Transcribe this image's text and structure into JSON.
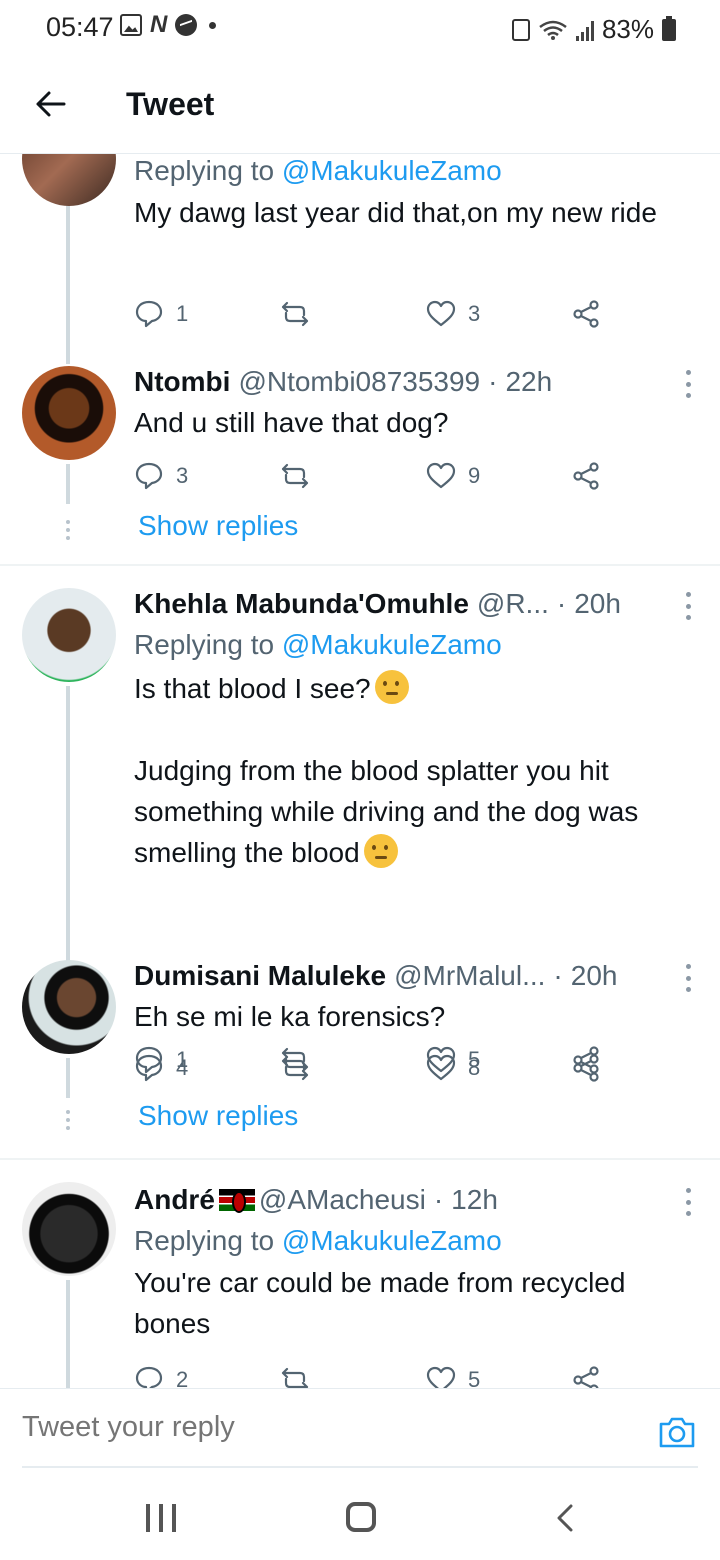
{
  "status_bar": {
    "time": "05:47",
    "battery": "83%"
  },
  "header": {
    "title": "Tweet"
  },
  "tweets": [
    {
      "name": "",
      "handle": "",
      "time": "",
      "replying_to_prefix": "Replying to ",
      "replying_to_handle": "@MakukuleZamo",
      "text": "My dawg last year did that,on my new ride",
      "replies": "1",
      "retweets": "",
      "likes": "3",
      "avatar_color": "#7a4a3a"
    },
    {
      "name": "Ntombi",
      "handle": "@Ntombi08735399",
      "time": "22h",
      "text": "And u still have that dog?",
      "replies": "3",
      "retweets": "",
      "likes": "9",
      "show_replies": "Show replies",
      "avatar_color": "#8a4a1c"
    },
    {
      "name": "Khehla Mabunda'Omuhle",
      "handle": "@R...",
      "time": "20h",
      "replying_to_prefix": "Replying to ",
      "replying_to_handle": "@MakukuleZamo",
      "text_line1": "Is that blood I see?",
      "text_rest": "Judging from the blood splatter you hit something while driving and the dog was smelling the blood",
      "replies": "1",
      "retweets": "",
      "likes": "5",
      "avatar_color": "#c9d3d8"
    },
    {
      "name": "Dumisani Maluleke",
      "handle": "@MrMalul...",
      "time": "20h",
      "text": "Eh se mi le ka forensics?",
      "replies": "4",
      "retweets": "",
      "likes": "8",
      "show_replies": "Show replies",
      "avatar_color": "#4e3a2a"
    },
    {
      "name": "André",
      "handle": "@AMacheusi",
      "time": "12h",
      "replying_to_prefix": "Replying to ",
      "replying_to_handle": "@MakukuleZamo",
      "text": "You're car could be made from recycled bones",
      "replies": "2",
      "retweets": "",
      "likes": "5",
      "avatar_color": "#222222"
    }
  ],
  "compose": {
    "placeholder": "Tweet your reply"
  },
  "colors": {
    "accent": "#1d9bf0",
    "muted": "#536471",
    "text": "#0f1419"
  }
}
